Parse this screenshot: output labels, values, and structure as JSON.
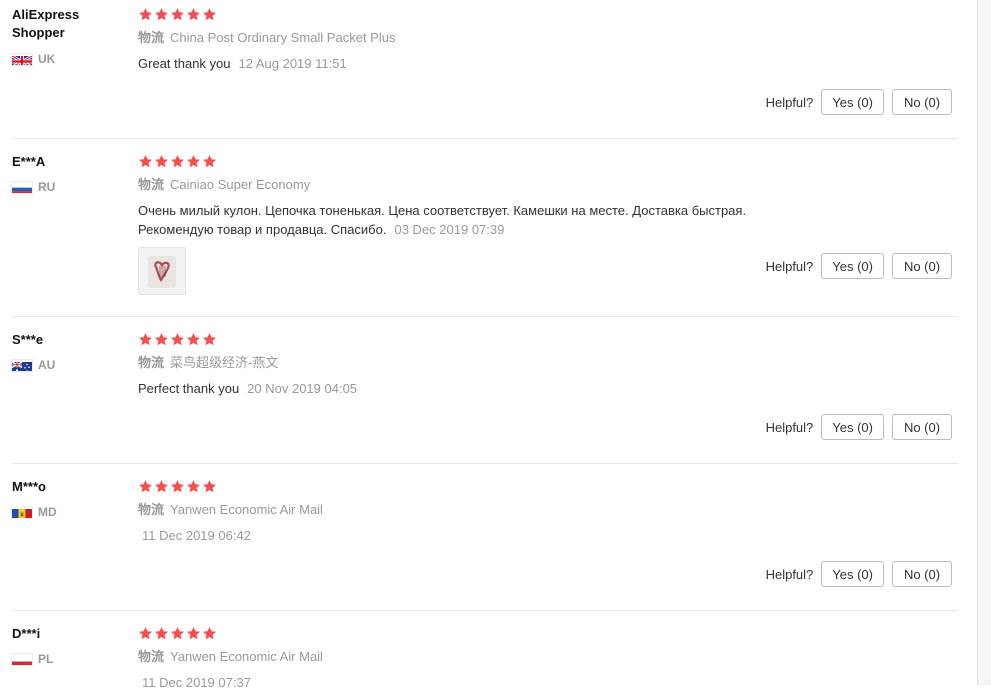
{
  "colors": {
    "star": "#f44f4f",
    "muted": "#999999",
    "text": "#333333",
    "separator": "#e8e8e8"
  },
  "helpful_label": "Helpful?",
  "reviews": [
    {
      "name": "AliExpress Shopper",
      "country": "UK",
      "flag_icon": "uk-flag-icon",
      "rating": 5,
      "logistics_label": "物流",
      "logistics": "China Post Ordinary Small Packet Plus",
      "text": "Great thank you",
      "date": "12 Aug 2019 11:51",
      "yes": "Yes (0)",
      "no": "No (0)"
    },
    {
      "name": "E***A",
      "country": "RU",
      "flag_icon": "ru-flag-icon",
      "rating": 5,
      "logistics_label": "物流",
      "logistics": "Cainiao Super Economy",
      "text": "Очень милый кулон. Цепочка тоненькая. Цена соответствует. Камешки на месте. Доставка быстрая. Рекомендую товар и продавца. Спасибо.",
      "date": "03 Dec 2019 07:39",
      "yes": "Yes (0)",
      "no": "No (0)"
    },
    {
      "name": "S***e",
      "country": "AU",
      "flag_icon": "au-flag-icon",
      "rating": 5,
      "logistics_label": "物流",
      "logistics": "菜鸟超级经济-燕文",
      "text": "Perfect thank you",
      "date": "20 Nov 2019 04:05",
      "yes": "Yes (0)",
      "no": "No (0)"
    },
    {
      "name": "M***o",
      "country": "MD",
      "flag_icon": "md-flag-icon",
      "rating": 5,
      "logistics_label": "物流",
      "logistics": "Yanwen Economic Air Mail",
      "text": "",
      "date": "11 Dec 2019 06:42",
      "yes": "Yes (0)",
      "no": "No (0)"
    },
    {
      "name": "D***i",
      "country": "PL",
      "flag_icon": "pl-flag-icon",
      "rating": 5,
      "logistics_label": "物流",
      "logistics": "Yanwen Economic Air Mail",
      "text": "",
      "date": "11 Dec 2019 07:37"
    }
  ]
}
